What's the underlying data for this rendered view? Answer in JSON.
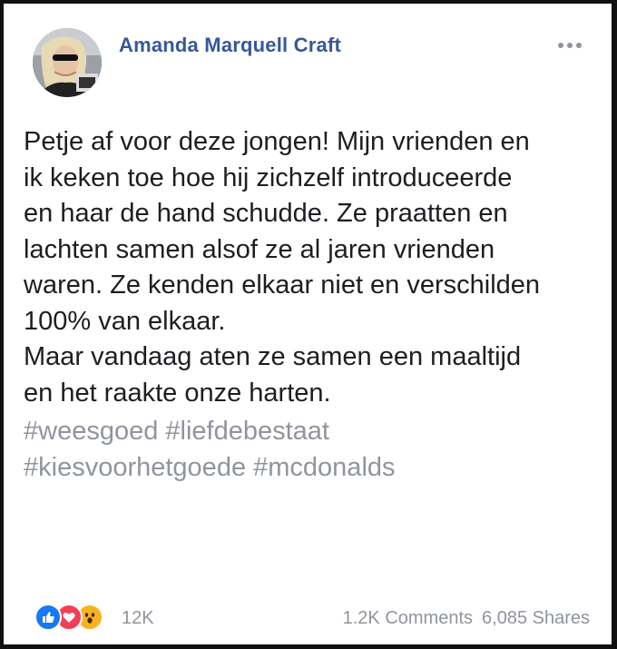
{
  "post": {
    "author": "Amanda Marquell Craft",
    "body_lines": [
      "Petje af voor deze jongen! Mijn vrienden en",
      "ik keken toe hoe hij zichzelf introduceerde",
      "en haar de hand schudde. Ze praatten en",
      "lachten samen alsof ze al jaren vrienden",
      "waren. Ze kenden elkaar niet en verschilden",
      "100% van elkaar.",
      "Maar vandaag aten ze samen een maaltijd",
      "en het raakte onze harten."
    ],
    "hashtags": {
      "tag1": "#weesgoed",
      "tag2": "#liefdebestaat",
      "tag3": "#kiesvoorhetgoede",
      "tag4": "#mcdonalds"
    }
  },
  "engagement": {
    "reactions": [
      "like-icon",
      "love-icon",
      "wow-icon"
    ],
    "reaction_count": "12K",
    "comments": "1.2K Comments",
    "shares": "6,085 Shares"
  },
  "colors": {
    "author": "#365899",
    "text": "#1c1e21",
    "hashtag": "#90949c",
    "meta": "#90949c",
    "like": "#1877f2",
    "love": "#f33e58",
    "wow": "#f7b125"
  },
  "icons": {
    "more": "more-options-icon"
  }
}
